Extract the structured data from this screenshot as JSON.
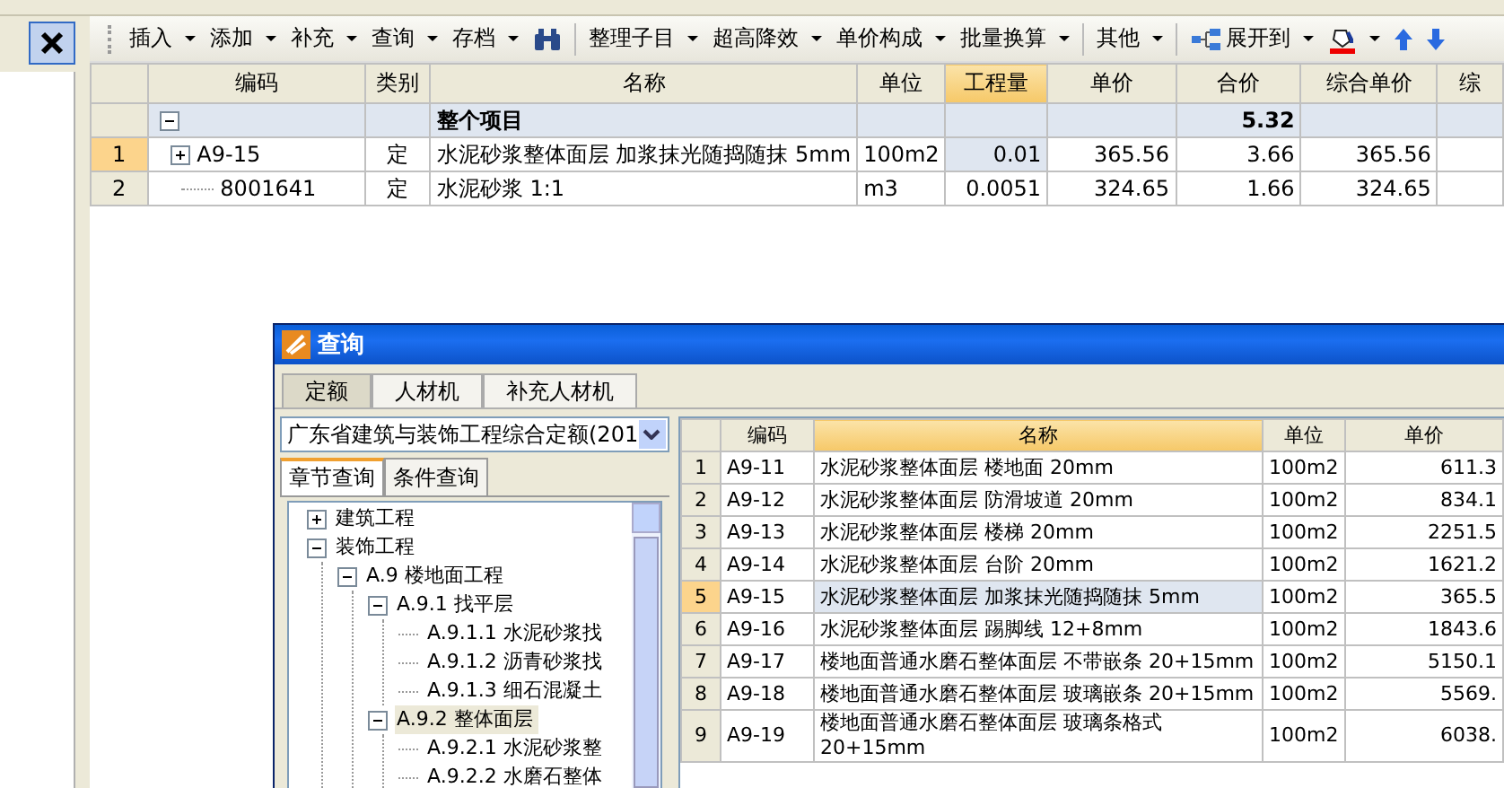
{
  "toolbar": [
    {
      "label": "插入",
      "kind": "menu"
    },
    {
      "label": "添加",
      "kind": "menu"
    },
    {
      "label": "补充",
      "kind": "menu"
    },
    {
      "label": "查询",
      "kind": "menu"
    },
    {
      "label": "存档",
      "kind": "menu"
    },
    {
      "kind": "find"
    },
    {
      "kind": "sep"
    },
    {
      "label": "整理子目",
      "kind": "menu"
    },
    {
      "label": "超高降效",
      "kind": "menu"
    },
    {
      "label": "单价构成",
      "kind": "menu"
    },
    {
      "label": "批量换算",
      "kind": "menu"
    },
    {
      "kind": "sep"
    },
    {
      "label": "其他",
      "kind": "menu"
    },
    {
      "kind": "sep"
    },
    {
      "label": "展开到",
      "kind": "expand"
    },
    {
      "kind": "fill"
    },
    {
      "kind": "up"
    },
    {
      "kind": "down"
    }
  ],
  "table": {
    "columns": [
      {
        "label": "编码",
        "selected": false
      },
      {
        "label": "类别",
        "selected": false
      },
      {
        "label": "名称",
        "selected": false
      },
      {
        "label": "单位",
        "selected": false
      },
      {
        "label": "工程量",
        "selected": true
      },
      {
        "label": "单价",
        "selected": false
      },
      {
        "label": "合价",
        "selected": false
      },
      {
        "label": "综合单价",
        "selected": false
      },
      {
        "label": "综",
        "selected": false
      }
    ],
    "rows": [
      {
        "kind": "group",
        "expanded": true,
        "selected": false,
        "name": "整个项目",
        "total": "5.32"
      },
      {
        "kind": "item",
        "number": "1",
        "expanded": false,
        "selected": true,
        "cells": [
          "A9-15",
          "定",
          "水泥砂浆整体面层 加浆抹光随捣随抹 5mm",
          "100m2",
          "0.01",
          "365.56",
          "3.66",
          "365.56"
        ]
      },
      {
        "kind": "item",
        "number": "2",
        "selected": false,
        "cells": [
          "8001641",
          "定",
          "水泥砂浆 1:1",
          "m3",
          "0.0051",
          "324.65",
          "1.66",
          "324.65"
        ]
      }
    ]
  },
  "dialog": {
    "title": "查询",
    "tabs": [
      {
        "label": "定额",
        "selected": true
      },
      {
        "label": "人材机",
        "selected": false
      },
      {
        "label": "补充人材机",
        "selected": false
      }
    ],
    "library": "广东省建筑与装饰工程综合定额(201",
    "subtabs": [
      {
        "label": "章节查询",
        "selected": true
      },
      {
        "label": "条件查询",
        "selected": false
      }
    ],
    "tree": [
      {
        "label": "建筑工程",
        "expanded": false,
        "selected": false
      },
      {
        "label": "装饰工程",
        "expanded": true,
        "selected": false,
        "children": [
          {
            "label": "A.9 楼地面工程",
            "expanded": true,
            "selected": false,
            "children": [
              {
                "label": "A.9.1 找平层",
                "expanded": true,
                "selected": false,
                "children": [
                  {
                    "label": "A.9.1.1 水泥砂浆找",
                    "selected": false
                  },
                  {
                    "label": "A.9.1.2 沥青砂浆找",
                    "selected": false
                  },
                  {
                    "label": "A.9.1.3 细石混凝土",
                    "selected": false
                  }
                ]
              },
              {
                "label": "A.9.2 整体面层",
                "expanded": true,
                "selected": true,
                "children": [
                  {
                    "label": "A.9.2.1 水泥砂浆整",
                    "selected": false
                  },
                  {
                    "label": "A.9.2.2 水磨石整体",
                    "selected": false
                  }
                ]
              }
            ]
          }
        ]
      }
    ],
    "grid": {
      "columns": [
        {
          "label": "编码",
          "selected": false
        },
        {
          "label": "名称",
          "selected": true
        },
        {
          "label": "单位",
          "selected": false
        },
        {
          "label": "单价",
          "selected": false
        }
      ],
      "rows": [
        {
          "number": "1",
          "code": "A9-11",
          "name": "水泥砂浆整体面层 楼地面 20mm",
          "unit": "100m2",
          "price": "611.3",
          "selected": false
        },
        {
          "number": "2",
          "code": "A9-12",
          "name": "水泥砂浆整体面层 防滑坡道 20mm",
          "unit": "100m2",
          "price": "834.1",
          "selected": false
        },
        {
          "number": "3",
          "code": "A9-13",
          "name": "水泥砂浆整体面层 楼梯 20mm",
          "unit": "100m2",
          "price": "2251.5",
          "selected": false
        },
        {
          "number": "4",
          "code": "A9-14",
          "name": "水泥砂浆整体面层 台阶 20mm",
          "unit": "100m2",
          "price": "1621.2",
          "selected": false
        },
        {
          "number": "5",
          "code": "A9-15",
          "name": "水泥砂浆整体面层 加浆抹光随捣随抹 5mm",
          "unit": "100m2",
          "price": "365.5",
          "selected": true
        },
        {
          "number": "6",
          "code": "A9-16",
          "name": "水泥砂浆整体面层 踢脚线 12+8mm",
          "unit": "100m2",
          "price": "1843.6",
          "selected": false
        },
        {
          "number": "7",
          "code": "A9-17",
          "name": "楼地面普通水磨石整体面层 不带嵌条 20+15mm",
          "unit": "100m2",
          "price": "5150.1",
          "selected": false
        },
        {
          "number": "8",
          "code": "A9-18",
          "name": "楼地面普通水磨石整体面层 玻璃嵌条 20+15mm",
          "unit": "100m2",
          "price": "5569.",
          "selected": false
        },
        {
          "number": "9",
          "code": "A9-19",
          "name": "楼地面普通水磨石整体面层 玻璃条格式 20+15mm",
          "unit": "100m2",
          "price": "6038.",
          "selected": false
        }
      ]
    }
  }
}
